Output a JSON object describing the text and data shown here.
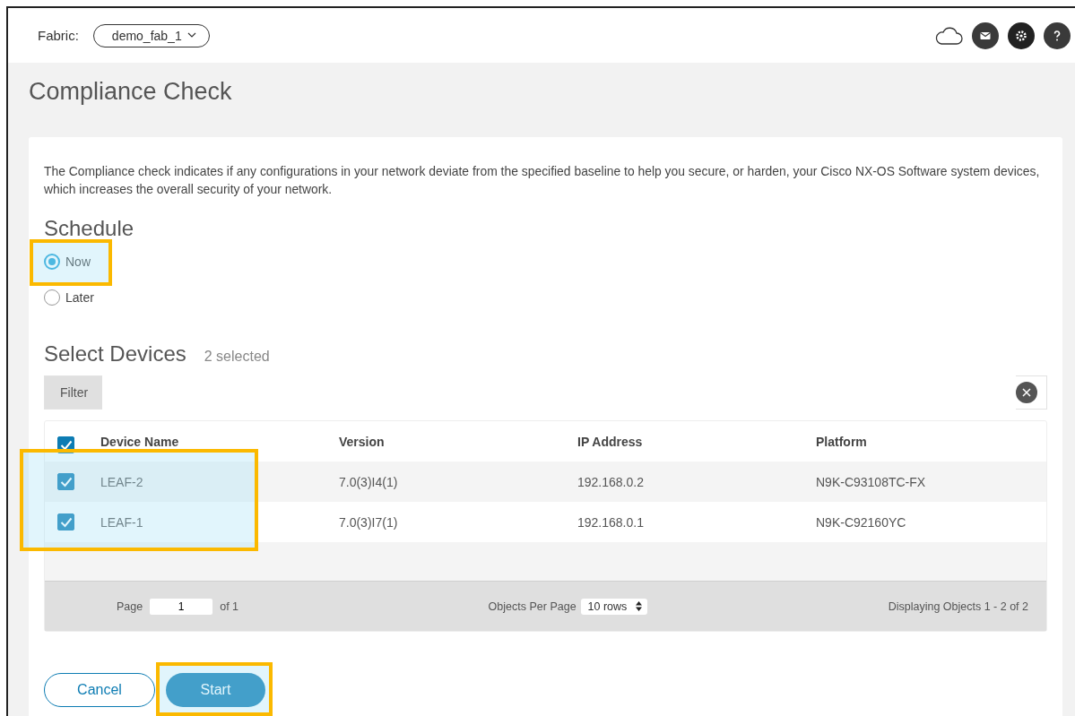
{
  "header": {
    "fabric_label": "Fabric:",
    "fabric_value": "demo_fab_1"
  },
  "page_title": "Compliance Check",
  "description": "The Compliance check indicates if any configurations in your network deviate from the specified baseline to help you secure, or harden, your Cisco NX-OS Software system devices, which increases the overall security of your network.",
  "schedule": {
    "title": "Schedule",
    "options": [
      {
        "label": "Now",
        "selected": true,
        "highlighted": true
      },
      {
        "label": "Later",
        "selected": false,
        "highlighted": false
      }
    ]
  },
  "devices": {
    "title": "Select Devices",
    "count": "2 selected",
    "filter_label": "Filter",
    "all_checked": true,
    "columns": [
      "Device Name",
      "Version",
      "IP Address",
      "Platform"
    ],
    "rows": [
      {
        "cells": [
          "LEAF-2",
          "7.0(3)I4(1)",
          "192.168.0.2",
          "N9K-C93108TC-FX"
        ],
        "checked": true
      },
      {
        "cells": [
          "LEAF-1",
          "7.0(3)I7(1)",
          "192.168.0.1",
          "N9K-C92160YC"
        ],
        "checked": true
      }
    ],
    "rows_highlighted": true,
    "pager": {
      "page_label": "Page",
      "page": "1",
      "of": "of 1",
      "per_page_label": "Objects Per Page",
      "per_page": "10 rows",
      "displaying": "Displaying Objects 1 - 2 of 2"
    }
  },
  "buttons": [
    {
      "label": "Cancel",
      "kind": "secondary",
      "highlighted": false
    },
    {
      "label": "Start",
      "kind": "primary",
      "highlighted": true
    }
  ]
}
